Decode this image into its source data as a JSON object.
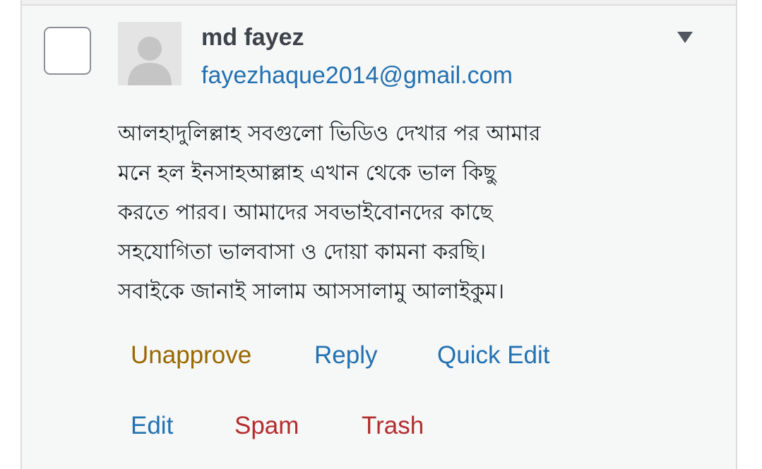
{
  "comment": {
    "author_name": "md fayez",
    "author_email": "fayezhaque2014@gmail.com",
    "body_lines": [
      "আলহাদুলিল্লাহ সবগুলো ভিডিও দেখার পর আমার",
      "মনে হল ইনসাহআল্লাহ এখান থেকে ভাল কিছু",
      "করতে পারব। আমাদের সবভাইবোনদের কাছে",
      "সহযোগিতা ভালবাসা ও দোয়া কামনা করছি।",
      "সবাইকে জানাই সালাম আসসালামু আলাইকুম।"
    ]
  },
  "row_actions": {
    "unapprove": "Unapprove",
    "reply": "Reply",
    "quick_edit": "Quick Edit",
    "edit": "Edit",
    "spam": "Spam",
    "trash": "Trash"
  },
  "icons": {
    "avatar": "default-avatar-icon",
    "toggle": "caret-down-icon"
  },
  "colors": {
    "link": "#2271b1",
    "unapprove": "#996800",
    "destructive": "#b32d2e",
    "author": "#3c434a",
    "background": "#f6f7f7"
  }
}
